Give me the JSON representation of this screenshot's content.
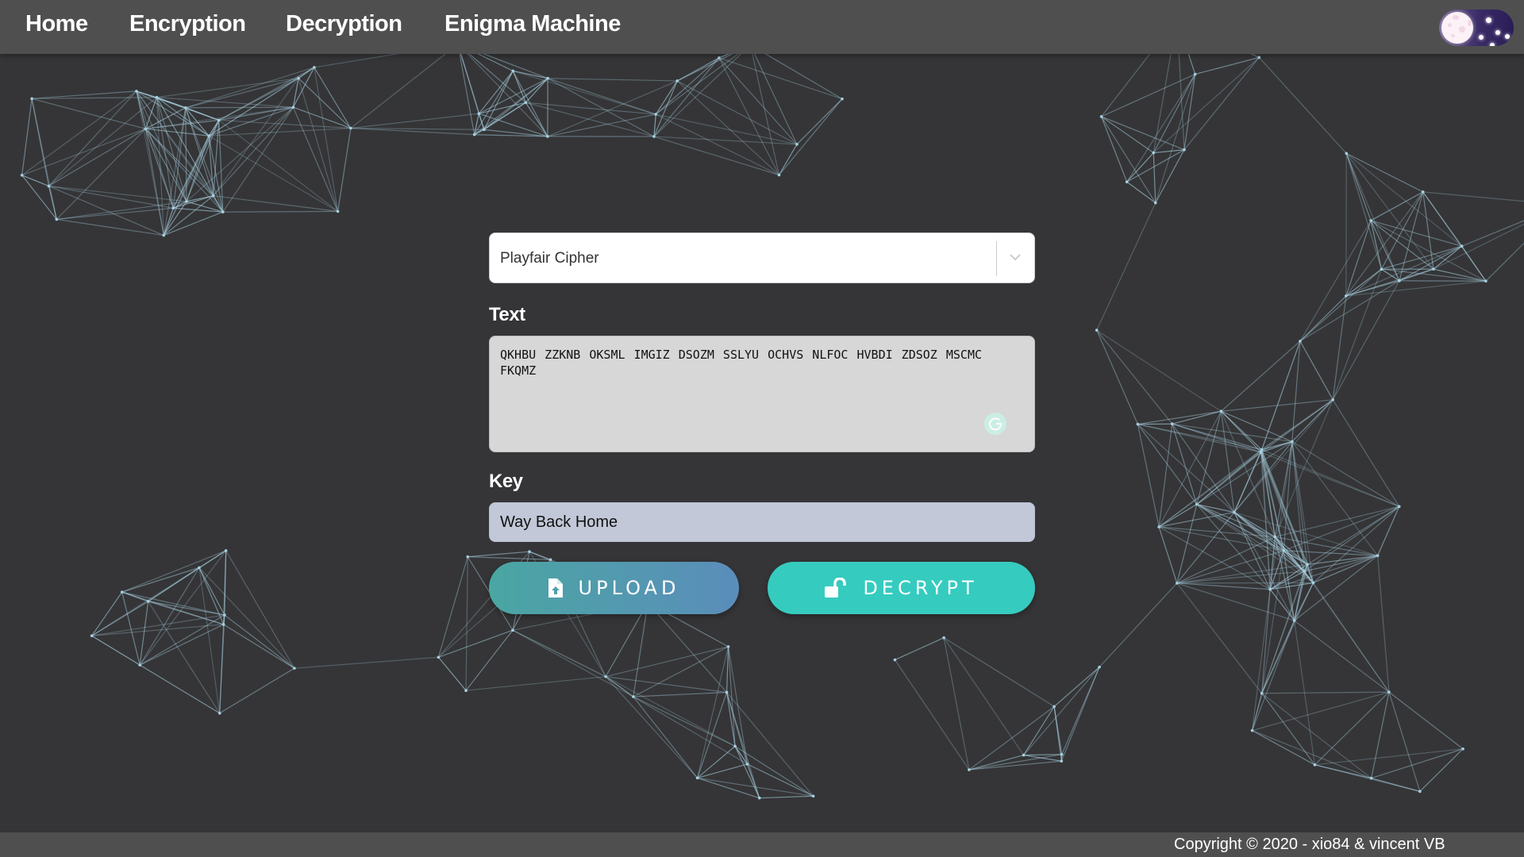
{
  "navbar": {
    "items": [
      {
        "label": "Home"
      },
      {
        "label": "Encryption"
      },
      {
        "label": "Decryption"
      },
      {
        "label": "Enigma Machine"
      }
    ],
    "theme_toggle": {
      "icon": "moon-night-toggle-icon",
      "state": "dark"
    }
  },
  "form": {
    "cipher_select": {
      "selected": "Playfair Cipher",
      "icon": "chevron-down-icon"
    },
    "text_label": "Text",
    "text_value": "QKHBU ZZKNB OKSML IMGIZ DSOZM SSLYU OCHVS NLFOC HVBDI ZDSOZ MSCMC\nFKQMZ",
    "key_label": "Key",
    "key_value": "Way Back Home",
    "upload_button": {
      "label": "UPLOAD",
      "icon": "file-upload-icon"
    },
    "decrypt_button": {
      "label": "DECRYPT",
      "icon": "unlock-icon"
    }
  },
  "footer": {
    "copyright": "Copyright © 2020 - xio84 & vincent VB"
  },
  "colors": {
    "background": "#353537",
    "navbar": "#4f4f4f",
    "network_lines": "#a8d0e0",
    "upload_gradient_start": "#4aa6a2",
    "upload_gradient_end": "#5b8dbb",
    "decrypt": "#36cbbf"
  }
}
